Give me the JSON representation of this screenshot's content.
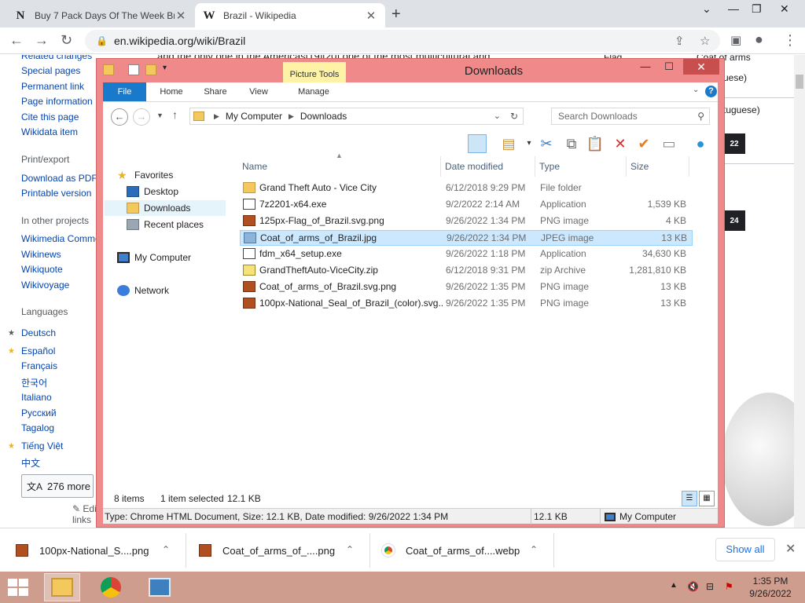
{
  "browser": {
    "tabs": [
      {
        "favicon": "N",
        "title": "Buy 7 Pack Days Of The Week Bri",
        "active": false
      },
      {
        "favicon": "W",
        "title": "Brazil - Wikipedia",
        "active": true
      }
    ],
    "new_tab_label": "+",
    "url": "en.wikipedia.org/wiki/Brazil"
  },
  "wiki": {
    "sidebar": {
      "clipped_top": "Related changes",
      "tools": [
        "Special pages",
        "Permanent link",
        "Page information",
        "Cite this page",
        "Wikidata item"
      ],
      "print_heading": "Print/export",
      "print_links": [
        "Download as PDF",
        "Printable version"
      ],
      "projects_heading": "In other projects",
      "projects": [
        "Wikimedia Commons",
        "Wikinews",
        "Wikiquote",
        "Wikivoyage"
      ],
      "languages_heading": "Languages",
      "languages": [
        "Deutsch",
        "Español",
        "Français",
        "한국어",
        "Italiano",
        "Русский",
        "Tagalog",
        "Tiếng Việt",
        "中文"
      ],
      "more_languages": "276 more",
      "edit_links": "Edit links"
    },
    "right": {
      "flag_label": "Flag",
      "coat_label": "Coat of arms",
      "portuguese_1": "uese)",
      "portuguese_2": "tuguese)",
      "badge_1": "22",
      "badge_2": "24"
    },
    "clipped_body_text": "and the only one in the Americas[19][20] one of the most multicultural and"
  },
  "explorer": {
    "title": "Downloads",
    "picture_tools": "Picture Tools",
    "ribbon_tabs": [
      "File",
      "Home",
      "Share",
      "View",
      "Manage"
    ],
    "address": {
      "root": "My Computer",
      "folder": "Downloads"
    },
    "search_placeholder": "Search Downloads",
    "nav": {
      "favorites": "Favorites",
      "desktop": "Desktop",
      "downloads": "Downloads",
      "recent": "Recent places",
      "computer": "My Computer",
      "network": "Network"
    },
    "columns": {
      "name": "Name",
      "date": "Date modified",
      "type": "Type",
      "size": "Size"
    },
    "files": [
      {
        "name": "Grand Theft Auto - Vice City",
        "date": "6/12/2018 9:29 PM",
        "type": "File folder",
        "size": "",
        "icon": "folder-icon",
        "selected": false
      },
      {
        "name": "7z2201-x64.exe",
        "date": "9/2/2022 2:14 AM",
        "type": "Application",
        "size": "1,539 KB",
        "icon": "application-icon",
        "selected": false
      },
      {
        "name": "125px-Flag_of_Brazil.svg.png",
        "date": "9/26/2022 1:34 PM",
        "type": "PNG image",
        "size": "4 KB",
        "icon": "png-icon",
        "selected": false
      },
      {
        "name": "Coat_of_arms_of_Brazil.jpg",
        "date": "9/26/2022 1:34 PM",
        "type": "JPEG image",
        "size": "13 KB",
        "icon": "jpeg-icon",
        "selected": true
      },
      {
        "name": "fdm_x64_setup.exe",
        "date": "9/26/2022 1:18 PM",
        "type": "Application",
        "size": "34,630 KB",
        "icon": "application-icon",
        "selected": false
      },
      {
        "name": "GrandTheftAuto-ViceCity.zip",
        "date": "6/12/2018 9:31 PM",
        "type": "zip Archive",
        "size": "1,281,810 KB",
        "icon": "zip-icon",
        "selected": false
      },
      {
        "name": "Coat_of_arms_of_Brazil.svg.png",
        "date": "9/26/2022 1:35 PM",
        "type": "PNG image",
        "size": "13 KB",
        "icon": "png-icon",
        "selected": false
      },
      {
        "name": "100px-National_Seal_of_Brazil_(color).svg...",
        "date": "9/26/2022 1:35 PM",
        "type": "PNG image",
        "size": "13 KB",
        "icon": "png-icon",
        "selected": false
      }
    ],
    "status": {
      "items": "8 items",
      "selected": "1 item selected",
      "size": "12.1 KB"
    },
    "details": {
      "text": "Type: Chrome HTML Document, Size: 12.1 KB, Date modified: 9/26/2022 1:34 PM",
      "size": "12.1 KB",
      "location": "My Computer"
    }
  },
  "downloads_shelf": {
    "items": [
      {
        "name": "100px-National_S....png",
        "icon": "png-icon"
      },
      {
        "name": "Coat_of_arms_of_....png",
        "icon": "png-icon"
      },
      {
        "name": "Coat_of_arms_of....webp",
        "icon": "chrome-icon"
      }
    ],
    "show_all": "Show all"
  },
  "taskbar": {
    "time": "1:35 PM",
    "date": "9/26/2022"
  }
}
